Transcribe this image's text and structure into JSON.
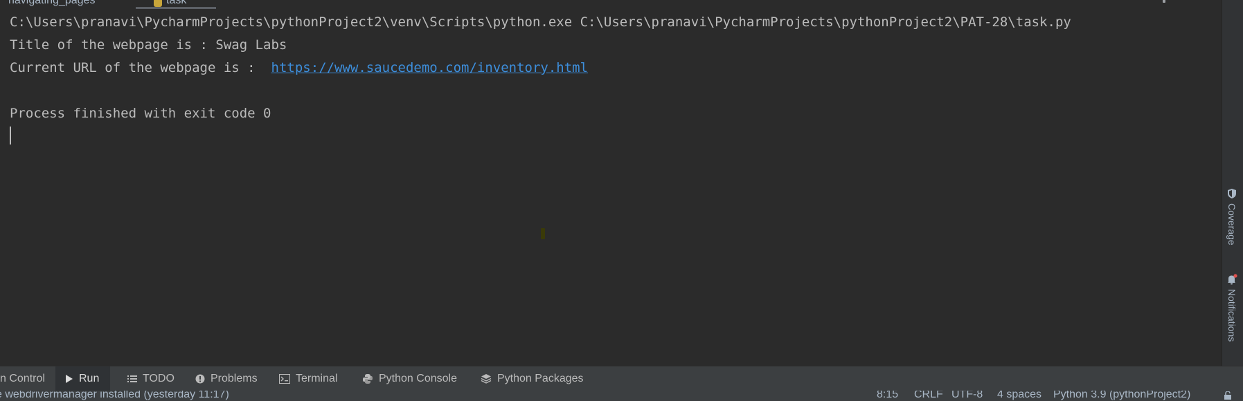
{
  "editor_tabs": [
    {
      "label": "navigating_pages"
    },
    {
      "label": "task"
    }
  ],
  "console": {
    "lines": [
      "C:\\Users\\pranavi\\PycharmProjects\\pythonProject2\\venv\\Scripts\\python.exe C:\\Users\\pranavi\\PycharmProjects\\pythonProject2\\PAT-28\\task.py",
      "Title of the webpage is : Swag Labs",
      "Current URL of the webpage is :  ",
      "Process finished with exit code 0"
    ],
    "url": "https://www.saucedemo.com/inventory.html"
  },
  "right_sidebar": {
    "coverage_label": "Coverage",
    "notifications_label": "Notifications"
  },
  "tool_tabs": {
    "version_control": "n Control",
    "run": "Run",
    "todo": "TODO",
    "problems": "Problems",
    "terminal": "Terminal",
    "python_console": "Python Console",
    "python_packages": "Python Packages"
  },
  "status_bar": {
    "message": "e webdrivermanager installed (yesterday 11:17)",
    "position": "8:15",
    "line_separator": "CRLF",
    "encoding": "UTF-8",
    "indent": "4 spaces",
    "interpreter": "Python 3.9 (pythonProject2)"
  },
  "colors": {
    "background": "#2b2b2b",
    "toolbar": "#3c3f41",
    "text": "#bbbbbb",
    "link": "#3d8edb"
  }
}
